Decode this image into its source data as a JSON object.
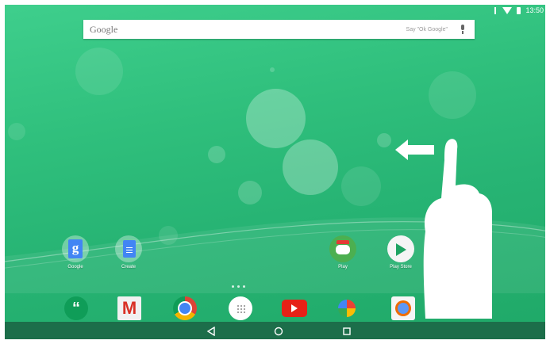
{
  "status_bar": {
    "time": "13:50",
    "icons": [
      "bluetooth-icon",
      "wifi-icon",
      "battery-icon"
    ]
  },
  "search": {
    "logo": "Google",
    "hint": "Say \"Ok Google\""
  },
  "apps": [
    {
      "id": "google",
      "label": "Google"
    },
    {
      "id": "create",
      "label": "Create"
    },
    {
      "id": "play",
      "label": "Play"
    },
    {
      "id": "play_store",
      "label": "Play Store"
    }
  ],
  "dock": [
    "hangouts-icon",
    "gmail-icon",
    "chrome-icon",
    "app-drawer-icon",
    "youtube-icon",
    "photos-icon",
    "camera-icon"
  ],
  "gesture": {
    "direction": "left"
  },
  "colors": {
    "wallpaper": "#2fbf7c",
    "navbar": "#1c6e4a"
  }
}
